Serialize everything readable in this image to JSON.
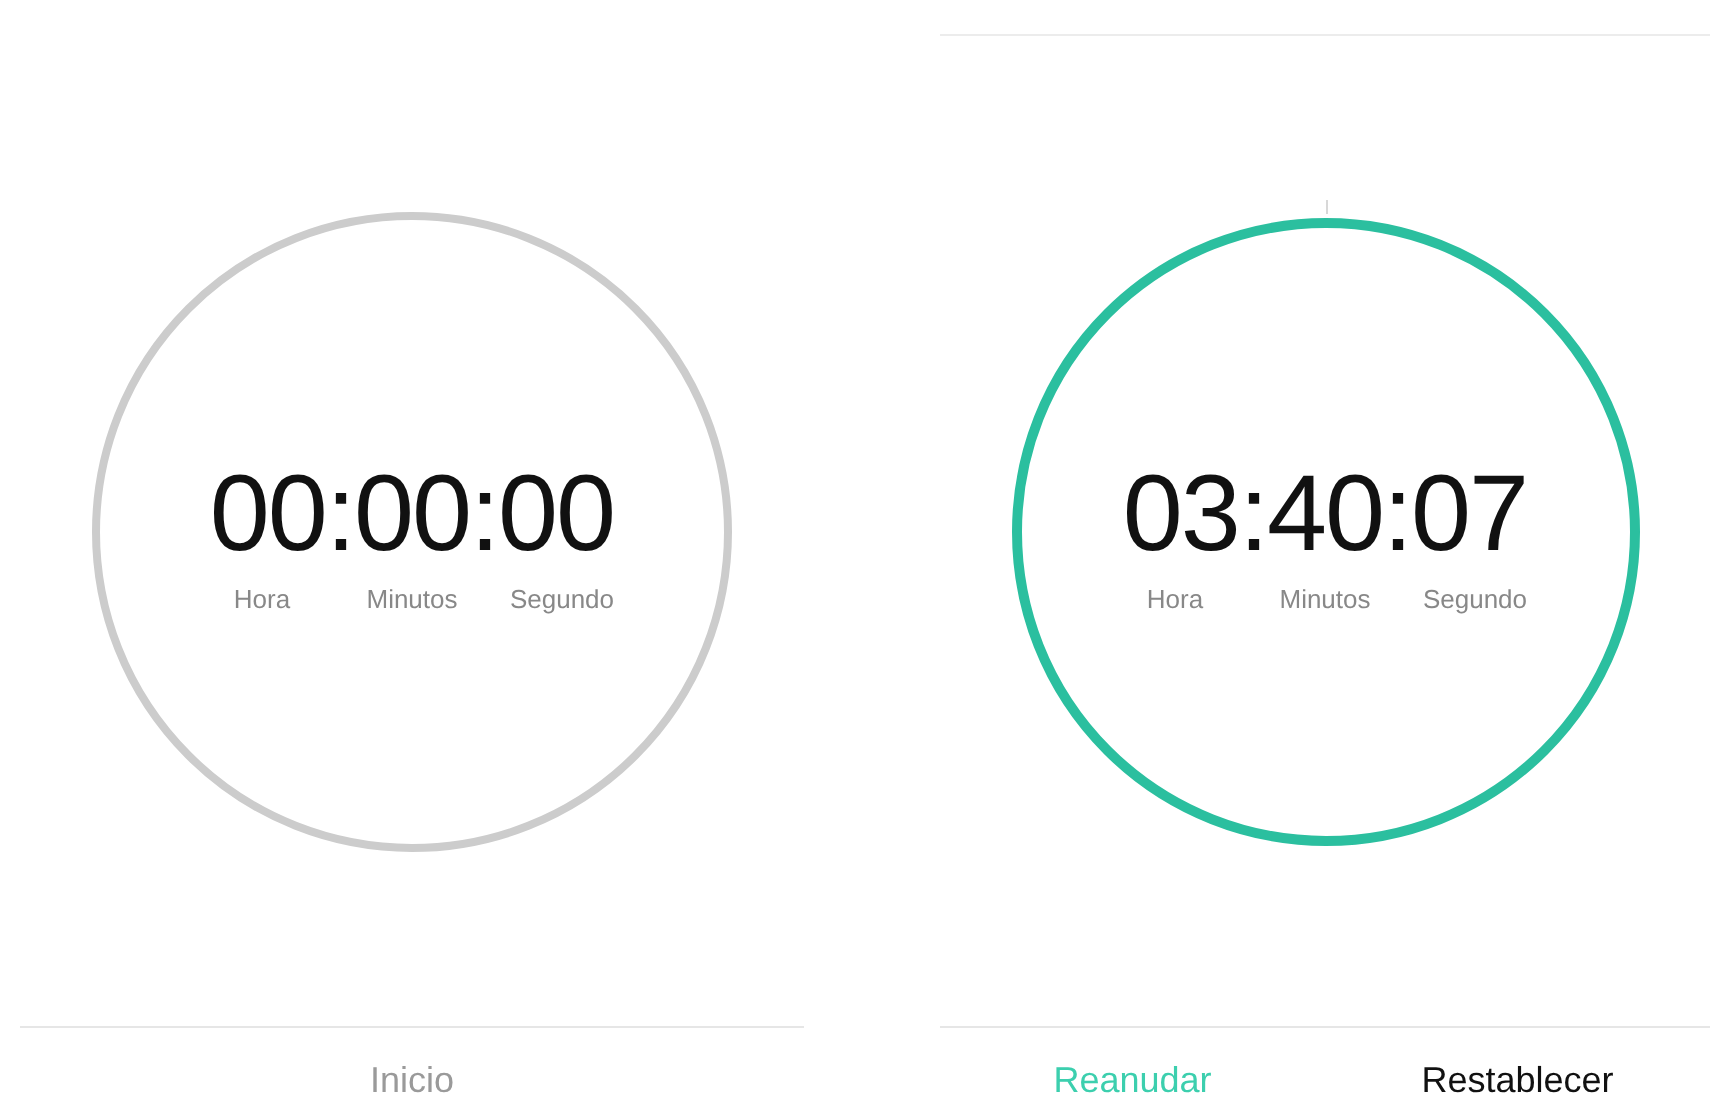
{
  "panels": [
    {
      "running": false,
      "top_rule": false,
      "time": "00:00:00",
      "units": [
        "Hora",
        "Minutos",
        "Segundo"
      ],
      "buttons": [
        {
          "label": "Inicio",
          "kind": "disabled"
        }
      ]
    },
    {
      "running": true,
      "top_rule": true,
      "time": "03:40:07",
      "units": [
        "Hora",
        "Minutos",
        "Segundo"
      ],
      "buttons": [
        {
          "label": "Reanudar",
          "kind": "accent"
        },
        {
          "label": "Restablecer",
          "kind": "plain"
        }
      ]
    }
  ]
}
